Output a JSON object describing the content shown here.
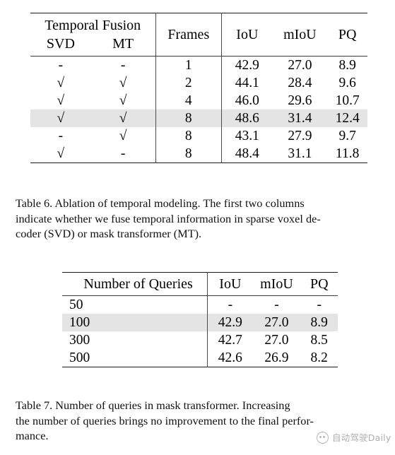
{
  "document": {
    "type": "academic-paper-excerpt",
    "background_color": "#ffffff",
    "text_color": "#000000",
    "highlight_color": "#e4e4e4"
  },
  "table6": {
    "id": "table-6",
    "group_header": "Temporal Fusion",
    "headers": [
      "SVD",
      "MT",
      "Frames",
      "IoU",
      "mIoU",
      "PQ"
    ],
    "check_glyph": "√",
    "dash_glyph": "-",
    "rows": [
      {
        "svd": "-",
        "mt": "-",
        "frames": "1",
        "iou": "42.9",
        "miou": "27.0",
        "pq": "8.9",
        "highlight": false,
        "bold": false
      },
      {
        "svd": "√",
        "mt": "√",
        "frames": "2",
        "iou": "44.1",
        "miou": "28.4",
        "pq": "9.6",
        "highlight": false,
        "bold": false
      },
      {
        "svd": "√",
        "mt": "√",
        "frames": "4",
        "iou": "46.0",
        "miou": "29.6",
        "pq": "10.7",
        "highlight": false,
        "bold": false
      },
      {
        "svd": "√",
        "mt": "√",
        "frames": "8",
        "iou": "48.6",
        "miou": "31.4",
        "pq": "12.4",
        "highlight": true,
        "bold": true
      },
      {
        "svd": "-",
        "mt": "√",
        "frames": "8",
        "iou": "43.1",
        "miou": "27.9",
        "pq": "9.7",
        "highlight": false,
        "bold": false
      },
      {
        "svd": "√",
        "mt": "-",
        "frames": "8",
        "iou": "48.4",
        "miou": "31.1",
        "pq": "11.8",
        "highlight": false,
        "bold": false
      }
    ],
    "caption": {
      "label": "Table 6.",
      "line1": "Table 6.  Ablation of temporal modeling.  The first two columns",
      "line2": "indicate whether we fuse temporal information in sparse voxel de-",
      "line3": "coder (SVD) or mask transformer (MT)."
    }
  },
  "table7": {
    "id": "table-7",
    "headers": [
      "Number of Queries",
      "IoU",
      "mIoU",
      "PQ"
    ],
    "rows": [
      {
        "queries": "50",
        "iou": "-",
        "miou": "-",
        "pq": "-",
        "highlight": false,
        "bold_iou": false,
        "bold_miou": false,
        "bold_pq": false
      },
      {
        "queries": "100",
        "iou": "42.9",
        "miou": "27.0",
        "pq": "8.9",
        "highlight": true,
        "bold_iou": true,
        "bold_miou": true,
        "bold_pq": false
      },
      {
        "queries": "300",
        "iou": "42.7",
        "miou": "27.0",
        "pq": "8.5",
        "highlight": false,
        "bold_iou": false,
        "bold_miou": false,
        "bold_pq": false
      },
      {
        "queries": "500",
        "iou": "42.6",
        "miou": "26.9",
        "pq": "8.2",
        "highlight": false,
        "bold_iou": false,
        "bold_miou": false,
        "bold_pq": false
      }
    ],
    "caption": {
      "label": "Table 7.",
      "line1": "Table 7.   Number of queries in mask transformer.   Increasing",
      "line2": "the number of queries brings no improvement to the final perfor-",
      "line3": "mance."
    }
  },
  "watermark": {
    "text": "自动驾驶Daily",
    "logo_icon": "circle-eyes-icon",
    "color": "#8f8f8f"
  }
}
